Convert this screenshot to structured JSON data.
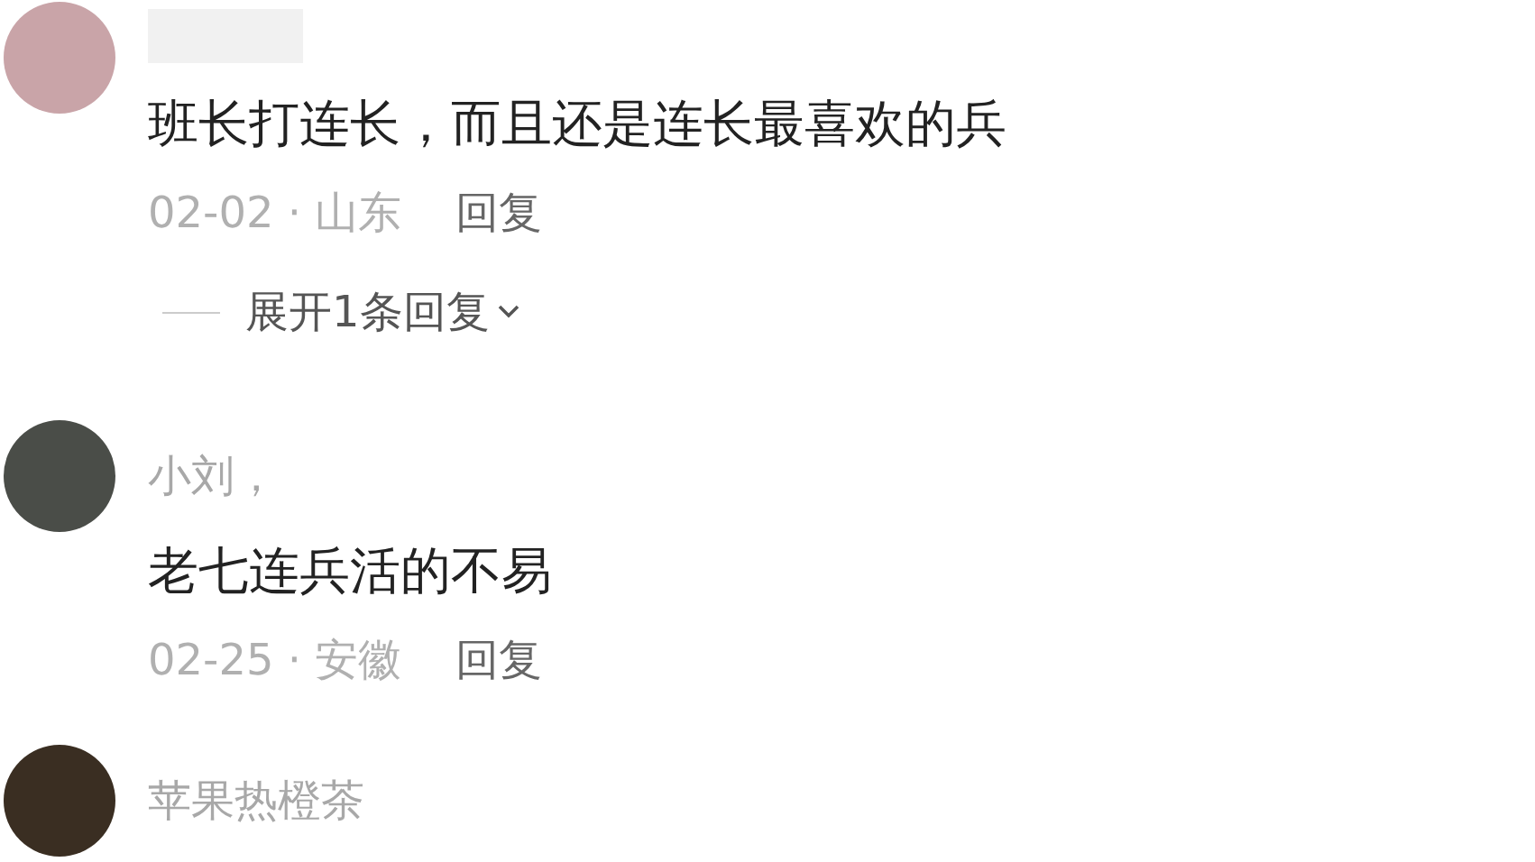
{
  "comments": [
    {
      "name_hidden": true,
      "text": "班长打连长，而且还是连长最喜欢的兵",
      "meta": "02-02 · 山东",
      "reply": "回复",
      "expand": {
        "label": "展开1条回复",
        "expanded": false
      }
    },
    {
      "name_hidden": false,
      "name": "小刘，",
      "text": "老七连兵活的不易",
      "meta": "02-25 · 安徽",
      "reply": "回复"
    },
    {
      "name_hidden": false,
      "name": "苹果热橙茶"
    }
  ]
}
